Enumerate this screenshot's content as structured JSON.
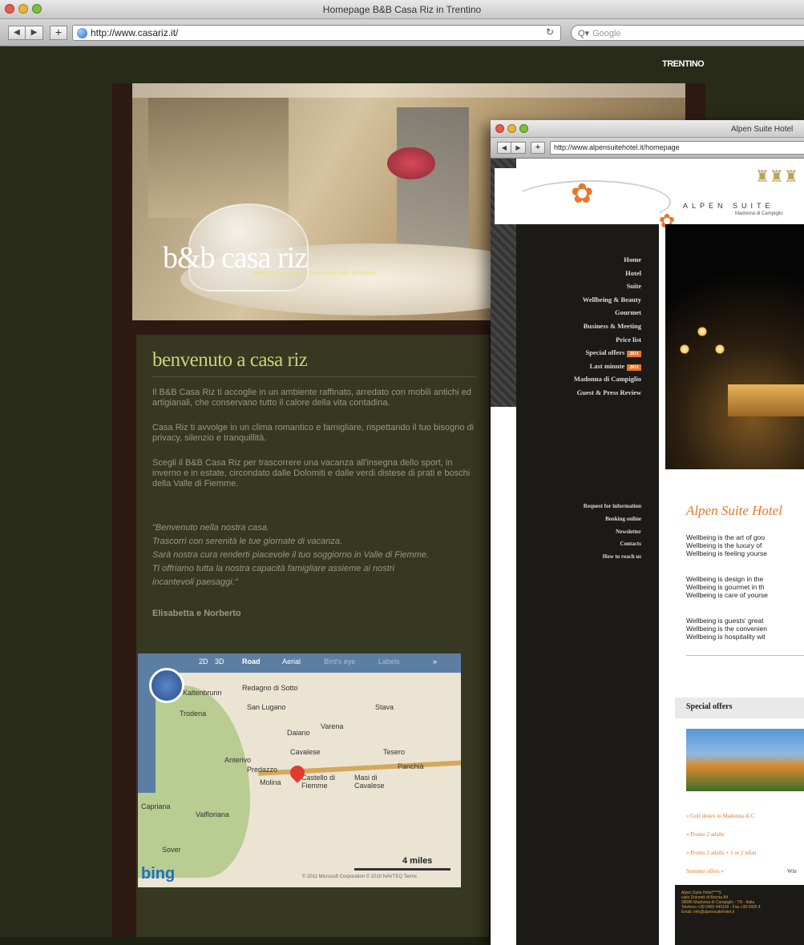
{
  "window1": {
    "title": "Homepage B&B Casa Riz in Trentino",
    "url": "http://www.casariz.it/",
    "search_placeholder": "Google"
  },
  "site1": {
    "trentino_logo": "TRENTINO",
    "logo": "b&b casa riz",
    "tagline": "bellezza da vivere nel cuore della valle di fiemme",
    "heading": "benvenuto a casa riz",
    "paragraphs": [
      "Il B&B Casa Riz ti accoglie in un ambiente raffinato, arredato con mobili antichi ed artigianali, che conservano tutto il calore della vita contadina.",
      "Casa Riz ti avvolge in un clima romantico e famigliare, rispettando il tuo bisogno di privacy, silenzio e tranquillità.",
      "Scegli il B&B Casa Riz per trascorrere una vacanza all'insegna dello sport, in inverno e in estate, circondato dalle Dolomiti e dalle verdi distese di prati e boschi della Valle di Fiemme."
    ],
    "quote": [
      "\"Benvenuto nella nostra casa.",
      "Trascorri con serenità le tue giornate di vacanza.",
      "Sarà nostra cura renderti piacevole il tuo soggiorno in Valle di Fiemme.",
      " Ti offriamo tutta la nostra capacità famigliare assieme ai nostri",
      "incantevoli paesaggi.\""
    ],
    "signature": "Elisabetta e Norberto"
  },
  "map": {
    "toolbar": [
      "2D",
      "3D",
      "Road",
      "Aerial",
      "Bird's eye",
      "Labels",
      "»"
    ],
    "places": [
      {
        "name": "Redagno di Sotto"
      },
      {
        "name": "Kaltenbrunn"
      },
      {
        "name": "Trodena"
      },
      {
        "name": "San Lugano"
      },
      {
        "name": "Stava"
      },
      {
        "name": "Anterivo"
      },
      {
        "name": "Daiano"
      },
      {
        "name": "Varena"
      },
      {
        "name": "Cavalese"
      },
      {
        "name": "Tesero"
      },
      {
        "name": "Castello di Fiemme"
      },
      {
        "name": "Masi di Cavalese"
      },
      {
        "name": "Panchià"
      },
      {
        "name": "Capriana"
      },
      {
        "name": "Valfloriana"
      },
      {
        "name": "Sover"
      },
      {
        "name": "Molina"
      },
      {
        "name": "Predazzo"
      }
    ],
    "scale_label": "4 miles",
    "brand": "bing",
    "copyright": "© 2011 Microsoft Corporation © 2010 NAVTEQ Terms"
  },
  "window2": {
    "title": "Alpen Suite Hotel",
    "url": "http://www.alpensuitehotel.it/homepage",
    "brand": "ALPEN SUITE",
    "location": "Madonna di Campiglio",
    "menu": [
      {
        "label": "Home",
        "badge": ""
      },
      {
        "label": "Hotel",
        "badge": ""
      },
      {
        "label": "Suite",
        "badge": ""
      },
      {
        "label": "Wellbeing & Beauty",
        "badge": ""
      },
      {
        "label": "Gourmet",
        "badge": ""
      },
      {
        "label": "Business & Meeting",
        "badge": ""
      },
      {
        "label": "Price list",
        "badge": ""
      },
      {
        "label": "Special offers",
        "badge": "2011"
      },
      {
        "label": "Last minute",
        "badge": "2011"
      },
      {
        "label": "Madonna di Campiglio",
        "badge": ""
      },
      {
        "label": "Guest & Press Review",
        "badge": ""
      }
    ],
    "submenu": [
      "Request for information",
      "Booking online",
      "Newsletter",
      "Contacts",
      "How to reach us"
    ],
    "heading": "Alpen Suite Hotel",
    "wellbeing1": [
      "Wellbeing is the art of goo",
      "Wellbeing is the luxury of",
      "Wellbeing is feeling yourse"
    ],
    "wellbeing2": [
      "Wellbeing is design in the",
      "Wellbeing is gourmet in th",
      "Wellbeing is care of yourse"
    ],
    "wellbeing3": [
      "Wellbeing is guests' great",
      "Wellbeing is the convenien",
      "Wellbeing is hospitality wit"
    ],
    "special_offers_title": "Special offers",
    "offer_links": [
      "» Golf desire in Madonna di C",
      "» Promo 2 adults",
      "» Promo 2 adults + 1 or 2 infan"
    ],
    "footer_links": [
      "Summer offers »",
      "Win"
    ],
    "footer_text": "Alpen Suite Hotel****S\nviale Dolomiti di Brenta 84\n38086 Madonna di Campiglio - TN - Italia\nTelefono +39 0465 440100 - Fax +39 0465 4\nEmail: info@alpensuitehotel.it"
  }
}
